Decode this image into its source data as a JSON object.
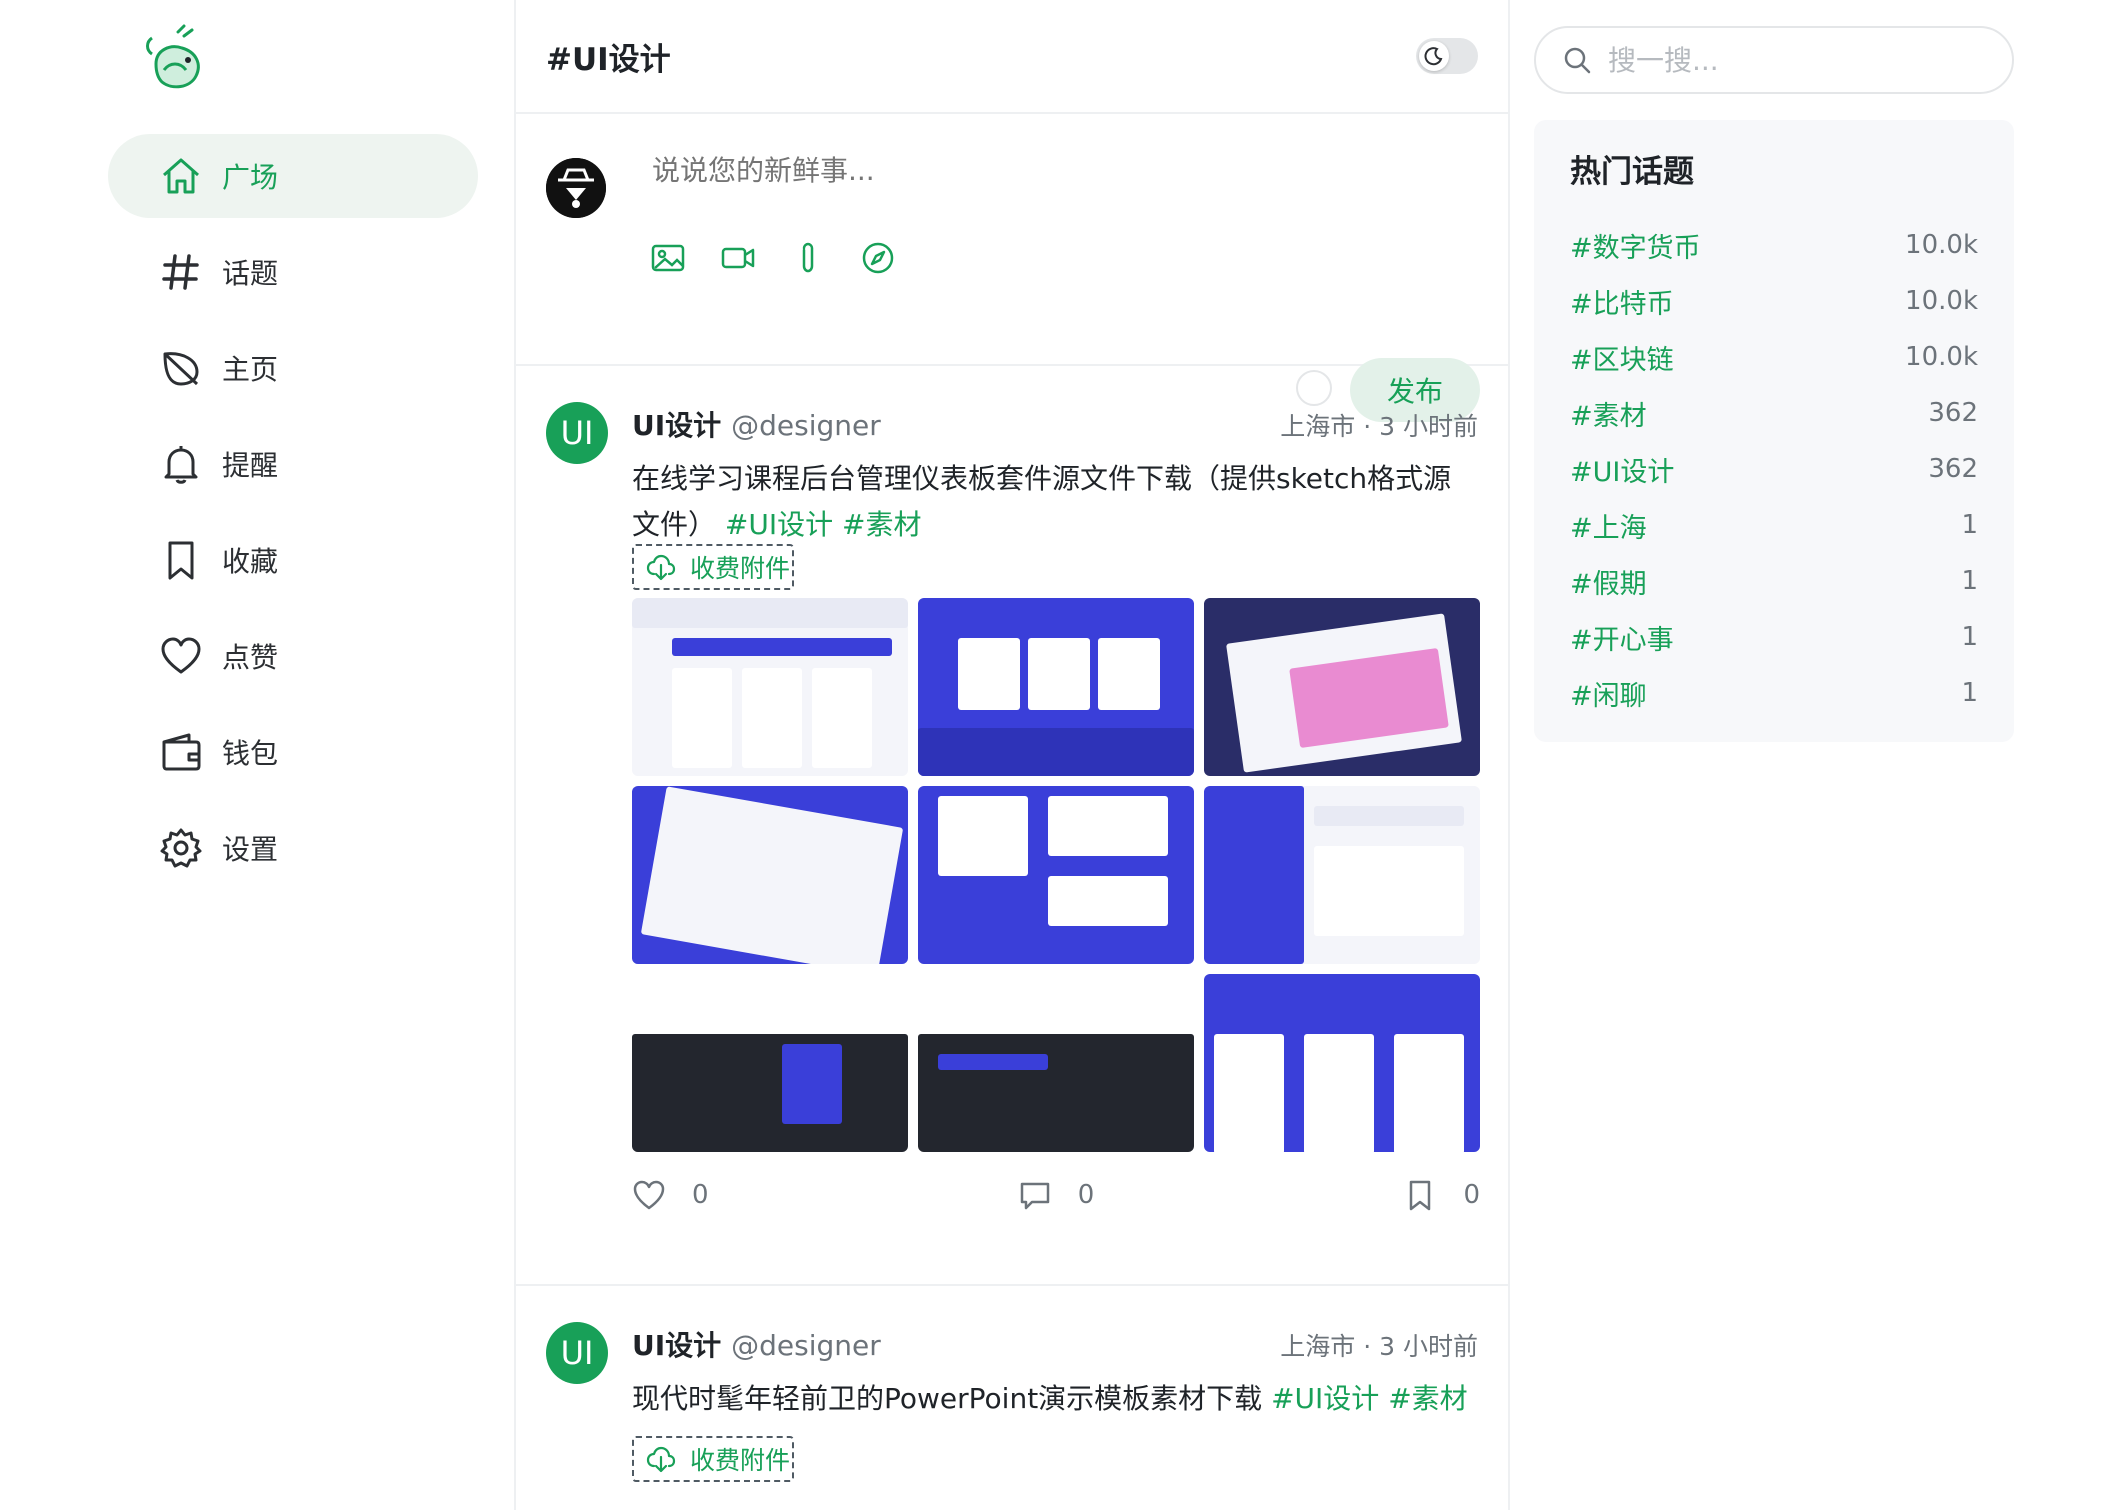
{
  "nav": {
    "items": [
      {
        "label": "广场",
        "icon": "home-icon",
        "active": true
      },
      {
        "label": "话题",
        "icon": "hash-icon",
        "active": false
      },
      {
        "label": "主页",
        "icon": "leaf-icon",
        "active": false
      },
      {
        "label": "提醒",
        "icon": "bell-icon",
        "active": false
      },
      {
        "label": "收藏",
        "icon": "bookmark-icon",
        "active": false
      },
      {
        "label": "点赞",
        "icon": "heart-icon",
        "active": false
      },
      {
        "label": "钱包",
        "icon": "wallet-icon",
        "active": false
      },
      {
        "label": "设置",
        "icon": "gear-icon",
        "active": false
      }
    ]
  },
  "header": {
    "title": "#UI设计"
  },
  "composer": {
    "placeholder": "说说您的新鲜事...",
    "publish_label": "发布"
  },
  "posts": [
    {
      "name": "UI设计",
      "username": "@designer",
      "avatar_text": "UI",
      "meta": "上海市 · 3 小时前",
      "text": "在线学习课程后台管理仪表板套件源文件下载（提供sketch格式源文件）",
      "tags": [
        "#UI设计",
        "#素材"
      ],
      "attachment_label": "收费附件",
      "likes": "0",
      "comments": "0",
      "collects": "0"
    },
    {
      "name": "UI设计",
      "username": "@designer",
      "avatar_text": "UI",
      "meta": "上海市 · 3 小时前",
      "text": "现代时髦年轻前卫的PowerPoint演示模板素材下载",
      "tags": [
        "#UI设计",
        "#素材"
      ],
      "attachment_label": "收费附件"
    }
  ],
  "search": {
    "placeholder": "搜一搜..."
  },
  "topics": {
    "title": "热门话题",
    "items": [
      {
        "name": "#数字货币",
        "count": "10.0k"
      },
      {
        "name": "#比特币",
        "count": "10.0k"
      },
      {
        "name": "#区块链",
        "count": "10.0k"
      },
      {
        "name": "#素材",
        "count": "362"
      },
      {
        "name": "#UI设计",
        "count": "362"
      },
      {
        "name": "#上海",
        "count": "1"
      },
      {
        "name": "#假期",
        "count": "1"
      },
      {
        "name": "#开心事",
        "count": "1"
      },
      {
        "name": "#闲聊",
        "count": "1"
      }
    ]
  },
  "colors": {
    "accent": "#18a058",
    "active_bg": "#eef4f0",
    "muted": "#6c737a",
    "border": "#eef0f2"
  }
}
